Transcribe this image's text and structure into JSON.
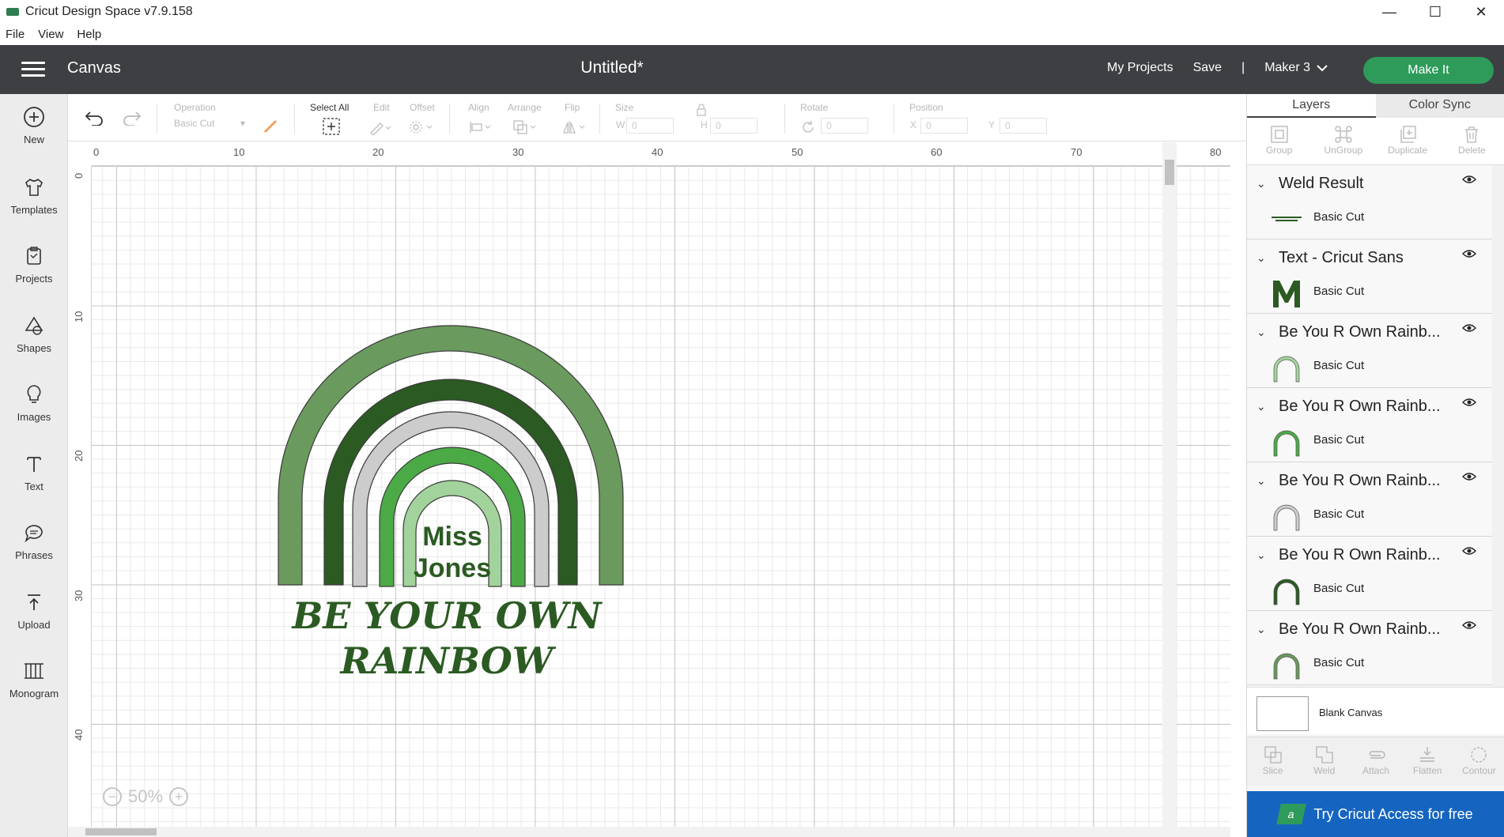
{
  "window": {
    "title": "Cricut Design Space  v7.9.158"
  },
  "menu": [
    "File",
    "View",
    "Help"
  ],
  "header": {
    "section": "Canvas",
    "document_title": "Untitled*",
    "my_projects": "My Projects",
    "save": "Save",
    "divider": "|",
    "machine": "Maker 3",
    "make_it": "Make It"
  },
  "sidebar": {
    "items": [
      {
        "label": "New",
        "icon": "plus-circle-icon"
      },
      {
        "label": "Templates",
        "icon": "shirt-icon"
      },
      {
        "label": "Projects",
        "icon": "projects-icon"
      },
      {
        "label": "Shapes",
        "icon": "shapes-icon"
      },
      {
        "label": "Images",
        "icon": "lightbulb-icon"
      },
      {
        "label": "Text",
        "icon": "text-icon"
      },
      {
        "label": "Phrases",
        "icon": "speech-bubble-icon"
      },
      {
        "label": "Upload",
        "icon": "upload-icon"
      },
      {
        "label": "Monogram",
        "icon": "monogram-icon"
      }
    ]
  },
  "toolbar": {
    "operation_label": "Operation",
    "operation_value": "Basic Cut",
    "select_all": "Select All",
    "edit": "Edit",
    "offset": "Offset",
    "align": "Align",
    "arrange": "Arrange",
    "flip": "Flip",
    "size": "Size",
    "w_label": "W",
    "w_value": "0",
    "h_label": "H",
    "h_value": "0",
    "rotate": "Rotate",
    "rotate_value": "0",
    "position": "Position",
    "x_label": "X",
    "x_value": "0",
    "y_label": "Y",
    "y_value": "0"
  },
  "canvas": {
    "ruler_top": [
      "0",
      "10",
      "20",
      "30",
      "40",
      "50",
      "60",
      "70",
      "80"
    ],
    "ruler_left": [
      "0",
      "10",
      "20",
      "30",
      "40"
    ],
    "zoom": "50%",
    "design_text": {
      "name_line1": "Miss",
      "name_line2": "Jones",
      "slogan_line1": "BE YOUR OWN",
      "slogan_line2": "RAINBOW"
    },
    "colors": {
      "outer_arc": "#6a9a5e",
      "dark_arc": "#2b5a22",
      "gray_arc": "#cccccc",
      "green_arc": "#4caa46",
      "light_arc": "#a3d39c",
      "text": "#2b5a22"
    }
  },
  "panel": {
    "tabs": [
      "Layers",
      "Color Sync"
    ],
    "tools": [
      "Group",
      "UnGroup",
      "Duplicate",
      "Delete"
    ],
    "layers": [
      {
        "name": "Weld Result",
        "operation": "Basic Cut"
      },
      {
        "name": "Text - Cricut Sans",
        "operation": "Basic Cut"
      },
      {
        "name": "Be You R Own Rainb...",
        "operation": "Basic Cut",
        "color": "#a3d39c"
      },
      {
        "name": "Be You R Own Rainb...",
        "operation": "Basic Cut",
        "color": "#4caa46"
      },
      {
        "name": "Be You R Own Rainb...",
        "operation": "Basic Cut",
        "color": "#cccccc"
      },
      {
        "name": "Be You R Own Rainb...",
        "operation": "Basic Cut",
        "color": "#2b5a22"
      },
      {
        "name": "Be You R Own Rainb...",
        "operation": "Basic Cut",
        "color": "#6a9a5e"
      }
    ],
    "blank_canvas": "Blank Canvas",
    "bottom_tools": [
      "Slice",
      "Weld",
      "Attach",
      "Flatten",
      "Contour"
    ],
    "access_banner": "Try Cricut Access for free"
  }
}
